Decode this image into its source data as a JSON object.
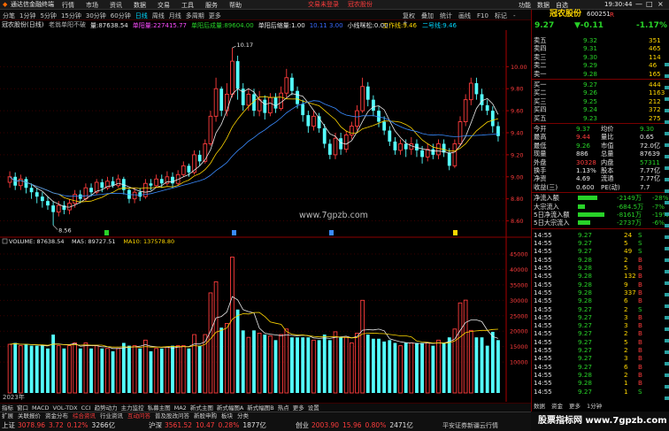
{
  "app": {
    "title": "通达信金融终端",
    "menu": [
      "行情",
      "市场",
      "资讯",
      "数据",
      "交易",
      "工具",
      "服务",
      "帮助"
    ],
    "login_notice": "交易未登录",
    "stock_tag": "冠农股份",
    "top_right": [
      "功能",
      "数据",
      "自选"
    ],
    "clock": "19:30:44"
  },
  "tabs": {
    "periods": [
      "分笔",
      "1分钟",
      "5分钟",
      "15分钟",
      "30分钟",
      "60分钟",
      "日线",
      "周线",
      "月线",
      "多周期",
      "更多"
    ],
    "tools": [
      "复权",
      "叠加",
      "统计",
      "画线",
      "F10",
      "标记",
      "-",
      "+"
    ],
    "active": "日线"
  },
  "chart_info": {
    "name": "冠农股份(日线)",
    "formula": "老翁单阳不破",
    "items": [
      {
        "label": "量:",
        "value": "87638.54",
        "color": "#e8e8e8"
      },
      {
        "label": "单阳量:",
        "value": "227415.77",
        "color": "#ff4cff"
      },
      {
        "label": "单阳后成量:",
        "value": "89604.00",
        "color": "#28d228"
      },
      {
        "label": "单阳后缩量:",
        "value": "1.00",
        "color": "#e8e8e8"
      },
      {
        "label": "",
        "value": "10.11 3.00",
        "color": "#3a6bff"
      },
      {
        "label": "小线咪松:",
        "value": "0.00",
        "color": "#e8e8e8"
      }
    ],
    "right_items": [
      {
        "label": "工作线:",
        "value": "9.46",
        "color": "#ffd700"
      },
      {
        "label": "二号线:",
        "value": "9.46",
        "color": "#00d8ff"
      }
    ]
  },
  "chart_data": {
    "type": "candlestick",
    "y_axis": {
      "ticks": [
        10.0,
        9.8,
        9.6,
        9.4,
        9.2,
        9.0,
        8.8,
        8.6
      ],
      "range": [
        8.5,
        10.3
      ]
    },
    "annotations": [
      {
        "text": "10.17"
      },
      {
        "text": "8.56"
      }
    ],
    "watermark": "www.7gpzb.com",
    "candles": [
      [
        8.95,
        9.0,
        9.05,
        8.9
      ],
      [
        9.0,
        8.92,
        9.04,
        8.88
      ],
      [
        8.92,
        8.98,
        9.02,
        8.88
      ],
      [
        8.98,
        8.9,
        9.0,
        8.85
      ],
      [
        8.9,
        8.86,
        8.94,
        8.8
      ],
      [
        8.86,
        8.82,
        8.9,
        8.76
      ],
      [
        8.82,
        8.78,
        8.86,
        8.72
      ],
      [
        8.78,
        8.74,
        8.82,
        8.7
      ],
      [
        8.74,
        8.68,
        8.78,
        8.56
      ],
      [
        8.68,
        8.74,
        8.78,
        8.64
      ],
      [
        8.74,
        8.7,
        8.78,
        8.66
      ],
      [
        8.7,
        8.76,
        8.8,
        8.66
      ],
      [
        8.76,
        8.84,
        8.88,
        8.72
      ],
      [
        8.84,
        8.8,
        8.88,
        8.76
      ],
      [
        8.8,
        8.9,
        8.94,
        8.78
      ],
      [
        8.9,
        8.86,
        8.94,
        8.82
      ],
      [
        8.86,
        8.95,
        8.98,
        8.84
      ],
      [
        8.95,
        8.9,
        8.98,
        8.86
      ],
      [
        8.9,
        8.96,
        9.0,
        8.88
      ],
      [
        8.96,
        8.92,
        9.0,
        8.9
      ],
      [
        8.92,
        8.98,
        9.02,
        8.9
      ],
      [
        8.98,
        8.88,
        9.0,
        8.84
      ],
      [
        8.88,
        8.8,
        8.9,
        8.76
      ],
      [
        8.8,
        8.86,
        8.9,
        8.76
      ],
      [
        8.86,
        8.82,
        8.9,
        8.78
      ],
      [
        8.82,
        8.94,
        8.98,
        8.8
      ],
      [
        8.94,
        8.92,
        8.98,
        8.88
      ],
      [
        8.92,
        8.98,
        9.02,
        8.9
      ],
      [
        8.98,
        8.94,
        9.02,
        8.9
      ],
      [
        8.94,
        9.0,
        9.05,
        8.92
      ],
      [
        9.0,
        8.94,
        9.04,
        8.9
      ],
      [
        8.94,
        9.02,
        9.06,
        8.92
      ],
      [
        9.02,
        9.1,
        9.14,
        9.0
      ],
      [
        9.1,
        9.04,
        9.12,
        9.0
      ],
      [
        9.04,
        9.2,
        9.24,
        9.02
      ],
      [
        9.2,
        9.14,
        9.24,
        9.1
      ],
      [
        9.14,
        9.3,
        9.34,
        9.12
      ],
      [
        9.3,
        9.55,
        9.6,
        9.28
      ],
      [
        9.55,
        9.8,
        9.9,
        9.5
      ],
      [
        9.8,
        9.6,
        9.82,
        9.55
      ],
      [
        9.6,
        9.75,
        9.85,
        9.55
      ],
      [
        9.75,
        10.05,
        10.17,
        9.72
      ],
      [
        10.05,
        9.8,
        10.1,
        9.7
      ],
      [
        9.8,
        9.65,
        9.85,
        9.6
      ],
      [
        9.65,
        9.75,
        9.8,
        9.6
      ],
      [
        9.75,
        9.6,
        9.8,
        9.55
      ],
      [
        9.6,
        9.7,
        9.78,
        9.55
      ],
      [
        9.7,
        9.58,
        9.74,
        9.52
      ],
      [
        9.58,
        9.72,
        9.76,
        9.55
      ],
      [
        9.72,
        9.62,
        9.76,
        9.58
      ],
      [
        9.62,
        9.76,
        9.82,
        9.6
      ],
      [
        9.76,
        9.9,
        9.98,
        9.72
      ],
      [
        9.9,
        9.78,
        9.94,
        9.74
      ],
      [
        9.78,
        9.66,
        9.82,
        9.62
      ],
      [
        9.66,
        9.56,
        9.7,
        9.5
      ],
      [
        9.56,
        9.46,
        9.6,
        9.4
      ],
      [
        9.46,
        9.55,
        9.6,
        9.42
      ],
      [
        9.55,
        9.44,
        9.58,
        9.4
      ],
      [
        9.44,
        9.3,
        9.48,
        9.26
      ],
      [
        9.3,
        9.2,
        9.34,
        9.16
      ],
      [
        9.2,
        9.35,
        9.4,
        9.16
      ],
      [
        9.35,
        9.25,
        9.4,
        9.2
      ],
      [
        9.25,
        9.38,
        9.42,
        9.22
      ],
      [
        9.38,
        9.46,
        9.5,
        9.34
      ],
      [
        9.46,
        9.6,
        9.65,
        9.42
      ],
      [
        9.6,
        9.82,
        9.9,
        9.58
      ],
      [
        9.82,
        9.7,
        9.86,
        9.64
      ],
      [
        9.7,
        9.6,
        9.74,
        9.55
      ],
      [
        9.6,
        9.5,
        9.64,
        9.45
      ],
      [
        9.5,
        9.42,
        9.55,
        9.38
      ],
      [
        9.42,
        9.32,
        9.46,
        9.28
      ],
      [
        9.32,
        9.24,
        9.36,
        9.2
      ],
      [
        9.24,
        9.3,
        9.34,
        9.2
      ],
      [
        9.3,
        9.25,
        9.34,
        9.18
      ],
      [
        9.25,
        9.3,
        9.36,
        9.2
      ],
      [
        9.3,
        9.24,
        9.34,
        9.18
      ],
      [
        9.24,
        9.18,
        9.28,
        9.12
      ],
      [
        9.18,
        9.25,
        9.3,
        9.14
      ],
      [
        9.25,
        9.2,
        9.3,
        9.16
      ],
      [
        9.2,
        9.3,
        9.34,
        9.16
      ],
      [
        9.3,
        9.22,
        9.34,
        9.18
      ],
      [
        9.22,
        9.1,
        9.26,
        9.06
      ],
      [
        9.1,
        9.3,
        9.34,
        9.08
      ],
      [
        9.3,
        9.5,
        9.55,
        9.28
      ],
      [
        9.5,
        9.7,
        9.75,
        9.46
      ],
      [
        9.7,
        9.85,
        9.9,
        9.65
      ],
      [
        9.85,
        9.75,
        9.9,
        9.7
      ],
      [
        9.75,
        9.65,
        9.8,
        9.6
      ],
      [
        9.65,
        9.6,
        9.7,
        9.56
      ],
      [
        9.6,
        9.46,
        9.64,
        9.4
      ],
      [
        9.46,
        9.37,
        9.5,
        9.32
      ]
    ]
  },
  "volume_info": {
    "items": [
      {
        "label": "VOLUME:",
        "value": "87638.54",
        "color": "#e8e8e8"
      },
      {
        "label": "MA5:",
        "value": "89727.51",
        "color": "#e8e8e8"
      },
      {
        "label": "MA10:",
        "value": "137578.80",
        "color": "#ffd700"
      }
    ],
    "ticks": [
      "45000",
      "40000",
      "35000",
      "30000",
      "25000",
      "20000",
      "15000",
      "10000"
    ],
    "year_label": "2023年"
  },
  "bottom_tabs": [
    "指标",
    "窗口",
    "MACD",
    "VOL-TDX",
    "CCI",
    "趋势动力",
    "主力监控",
    "私募主图",
    "MA2",
    "新式主图",
    "新式幅图A",
    "新式幅图B",
    "热点",
    "更多",
    "设置"
  ],
  "bottom_tabs2": [
    "扩展",
    "关联报价",
    "资金分布",
    "综合资讯",
    "行业资讯",
    "互动问答",
    "普及股改问答",
    "新股申购",
    "板块",
    "分类"
  ],
  "right_panel": {
    "name": "冠农股份",
    "code": "600251",
    "price": "9.27",
    "change": "▼-0.11",
    "pct": "-1.17%",
    "asks": [
      {
        "label": "卖五",
        "price": "9.32",
        "vol": "351"
      },
      {
        "label": "卖四",
        "price": "9.31",
        "vol": "465"
      },
      {
        "label": "卖三",
        "price": "9.30",
        "vol": "114"
      },
      {
        "label": "卖二",
        "price": "9.29",
        "vol": "46"
      },
      {
        "label": "卖一",
        "price": "9.28",
        "vol": "165"
      }
    ],
    "bids": [
      {
        "label": "买一",
        "price": "9.27",
        "vol": "444"
      },
      {
        "label": "买二",
        "price": "9.26",
        "vol": "1163"
      },
      {
        "label": "买三",
        "price": "9.25",
        "vol": "212"
      },
      {
        "label": "买四",
        "price": "9.24",
        "vol": "372"
      },
      {
        "label": "买五",
        "price": "9.23",
        "vol": "275"
      }
    ],
    "stats": [
      {
        "l1": "今开",
        "v1": "9.37",
        "c1": "#28d228",
        "l2": "均价",
        "v2": "9.30",
        "c2": "#28d228"
      },
      {
        "l1": "最高",
        "v1": "9.44",
        "c1": "#ff3c3c",
        "l2": "量比",
        "v2": "0.65",
        "c2": "#e8e8e8"
      },
      {
        "l1": "最低",
        "v1": "9.26",
        "c1": "#28d228",
        "l2": "市值",
        "v2": "72.0亿",
        "c2": "#e8e8e8"
      },
      {
        "l1": "现量",
        "v1": "886",
        "c1": "#e8e8e8",
        "l2": "总量",
        "v2": "87639",
        "c2": "#e8e8e8"
      },
      {
        "l1": "外盘",
        "v1": "30328",
        "c1": "#ff3c3c",
        "l2": "内盘",
        "v2": "57311",
        "c2": "#28d228"
      },
      {
        "l1": "换手",
        "v1": "1.13%",
        "c1": "#e8e8e8",
        "l2": "股本",
        "v2": "7.77亿",
        "c2": "#e8e8e8"
      },
      {
        "l1": "净资",
        "v1": "4.69",
        "c1": "#e8e8e8",
        "l2": "流通",
        "v2": "7.77亿",
        "c2": "#e8e8e8"
      },
      {
        "l1": "收益(三)",
        "v1": "0.600",
        "c1": "#e8e8e8",
        "l2": "PE(动)",
        "v2": "7.7",
        "c2": "#e8e8e8"
      }
    ],
    "flows": [
      {
        "label": "净流入额",
        "value": "-2149万",
        "pct": "-28%",
        "bar": 0.55
      },
      {
        "label": "大宗流入",
        "value": "-684.5万",
        "pct": "-7%",
        "bar": 0.2
      },
      {
        "label": "5日净流入额",
        "value": "-8161万",
        "pct": "-19%",
        "bar": 0.75
      },
      {
        "label": "5日大宗流入",
        "value": "-2737万",
        "pct": "-6%",
        "bar": 0.35
      }
    ],
    "ticks": [
      {
        "time": "14:55",
        "price": "9.27",
        "vol": "24",
        "dir": "S"
      },
      {
        "time": "14:55",
        "price": "9.27",
        "vol": "5",
        "dir": "S"
      },
      {
        "time": "14:55",
        "price": "9.27",
        "vol": "49",
        "dir": "S"
      },
      {
        "time": "14:55",
        "price": "9.28",
        "vol": "2",
        "dir": "B"
      },
      {
        "time": "14:55",
        "price": "9.28",
        "vol": "5",
        "dir": "B"
      },
      {
        "time": "14:55",
        "price": "9.28",
        "vol": "132",
        "dir": "B"
      },
      {
        "time": "14:55",
        "price": "9.28",
        "vol": "9",
        "dir": "B"
      },
      {
        "time": "14:55",
        "price": "9.28",
        "vol": "337",
        "dir": "B"
      },
      {
        "time": "14:55",
        "price": "9.28",
        "vol": "6",
        "dir": "B"
      },
      {
        "time": "14:55",
        "price": "9.27",
        "vol": "2",
        "dir": "S"
      },
      {
        "time": "14:55",
        "price": "9.27",
        "vol": "3",
        "dir": "B"
      },
      {
        "time": "14:55",
        "price": "9.27",
        "vol": "3",
        "dir": "B"
      },
      {
        "time": "14:55",
        "price": "9.27",
        "vol": "2",
        "dir": "B"
      },
      {
        "time": "14:55",
        "price": "9.27",
        "vol": "5",
        "dir": "B"
      },
      {
        "time": "14:55",
        "price": "9.27",
        "vol": "2",
        "dir": "B"
      },
      {
        "time": "14:55",
        "price": "9.27",
        "vol": "3",
        "dir": "B"
      },
      {
        "time": "14:55",
        "price": "9.27",
        "vol": "6",
        "dir": "B"
      },
      {
        "time": "14:55",
        "price": "9.28",
        "vol": "2",
        "dir": "B"
      },
      {
        "time": "14:55",
        "price": "9.28",
        "vol": "1",
        "dir": "B"
      },
      {
        "time": "14:55",
        "price": "9.27",
        "vol": "1",
        "dir": "S"
      }
    ],
    "footer": [
      "数据",
      "资金",
      "更多",
      "1分钟"
    ]
  },
  "status": {
    "indices": [
      {
        "name": "上证",
        "value": "3078.96",
        "chg": "3.72",
        "pct": "0.12%",
        "amt": "3266亿",
        "color": "#ff3c3c"
      },
      {
        "name": "沪深",
        "value": "3561.52",
        "chg": "10.47",
        "pct": "0.28%",
        "amt": "1877亿",
        "color": "#ff3c3c"
      },
      {
        "name": "创业",
        "value": "2003.90",
        "chg": "15.96",
        "pct": "0.80%",
        "amt": "2471亿",
        "color": "#ff3c3c"
      }
    ],
    "broker": "平安证券新疆云行情",
    "watermark": "股票指标网 www.7gpzb.com"
  }
}
